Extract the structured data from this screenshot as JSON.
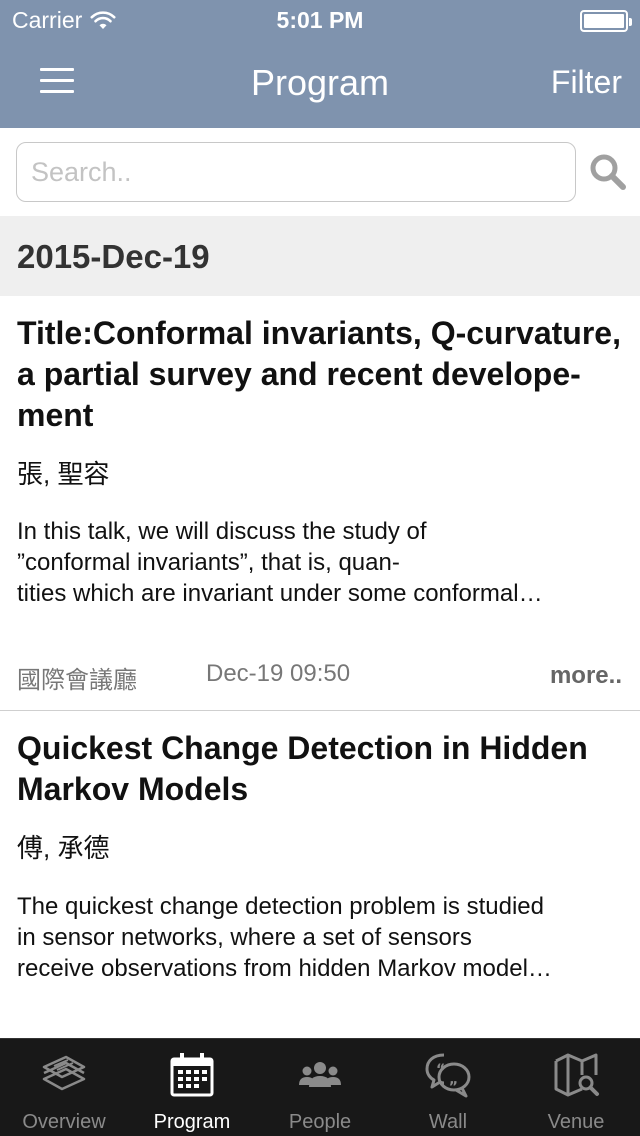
{
  "status": {
    "carrier": "Carrier",
    "time": "5:01 PM"
  },
  "nav": {
    "title": "Program",
    "filter_label": "Filter"
  },
  "search": {
    "placeholder": "Search.."
  },
  "date_header": "2015-Dec-19",
  "sessions": [
    {
      "title": "Title:Conformal invariants, Q-curvature, a partial survey and recent develope- ment",
      "speaker": "張, 聖容",
      "abstract_lines": [
        "In this talk, we will discuss the study of",
        "”conformal invariants”, that is, quan-",
        "tities which are invariant under some conformal…"
      ],
      "room": "國際會議廳",
      "time": "Dec-19 09:50",
      "more_label": "more.."
    },
    {
      "title": "Quickest Change Detection in Hidden Markov Models",
      "speaker": "傅, 承德",
      "abstract_lines": [
        "The quickest change detection problem is studied",
        "in sensor networks, where a set of sensors",
        "receive observations from hidden Markov model…"
      ]
    }
  ],
  "tabs": [
    {
      "label": "Overview",
      "icon": "newspaper-icon",
      "active": false
    },
    {
      "label": "Program",
      "icon": "calendar-icon",
      "active": true
    },
    {
      "label": "People",
      "icon": "people-icon",
      "active": false
    },
    {
      "label": "Wall",
      "icon": "chat-bubbles-icon",
      "active": false
    },
    {
      "label": "Venue",
      "icon": "map-search-icon",
      "active": false
    }
  ],
  "colors": {
    "nav_bg": "#7f93ae",
    "tabbar_bg": "#181818",
    "date_header_bg": "#efefef"
  }
}
